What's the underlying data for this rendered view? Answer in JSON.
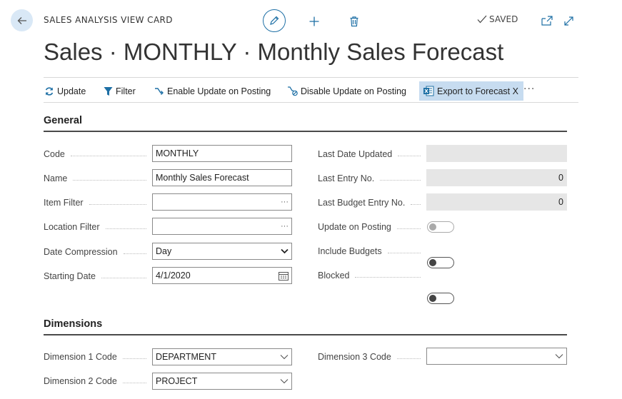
{
  "header": {
    "card_type": "SALES ANALYSIS VIEW CARD",
    "status": "SAVED",
    "title": "Sales · MONTHLY · Monthly Sales Forecast"
  },
  "actions": [
    {
      "label": "Update",
      "icon": "refresh-icon"
    },
    {
      "label": "Filter",
      "icon": "filter-icon"
    },
    {
      "label": "Enable Update on Posting",
      "icon": "enable-arrow-icon"
    },
    {
      "label": "Disable Update on Posting",
      "icon": "disable-icon"
    },
    {
      "label": "Export to Forecast X",
      "icon": "excel-icon"
    }
  ],
  "more_label": "···",
  "general": {
    "title": "General",
    "code": {
      "label": "Code",
      "value": "MONTHLY"
    },
    "name": {
      "label": "Name",
      "value": "Monthly Sales Forecast"
    },
    "item_filter": {
      "label": "Item Filter",
      "value": "",
      "assist": "···"
    },
    "location_filter": {
      "label": "Location Filter",
      "value": "",
      "assist": "···"
    },
    "date_compression": {
      "label": "Date Compression",
      "value": "Day"
    },
    "starting_date": {
      "label": "Starting Date",
      "value": "4/1/2020"
    },
    "last_date_updated": {
      "label": "Last Date Updated",
      "value": ""
    },
    "last_entry_no": {
      "label": "Last Entry No.",
      "value": "0"
    },
    "last_budget_entry_no": {
      "label": "Last Budget Entry No.",
      "value": "0"
    },
    "update_on_posting": {
      "label": "Update on Posting",
      "value": false,
      "disabled": true
    },
    "include_budgets": {
      "label": "Include Budgets",
      "value": false
    },
    "blocked": {
      "label": "Blocked",
      "value": false
    }
  },
  "dimensions": {
    "title": "Dimensions",
    "dim1": {
      "label": "Dimension 1 Code",
      "value": "DEPARTMENT"
    },
    "dim2": {
      "label": "Dimension 2 Code",
      "value": "PROJECT"
    },
    "dim3": {
      "label": "Dimension 3 Code",
      "value": ""
    }
  },
  "colors": {
    "accent": "#1d6fa5",
    "highlight": "#c7dcf0",
    "readonly": "#e6e6e6"
  }
}
